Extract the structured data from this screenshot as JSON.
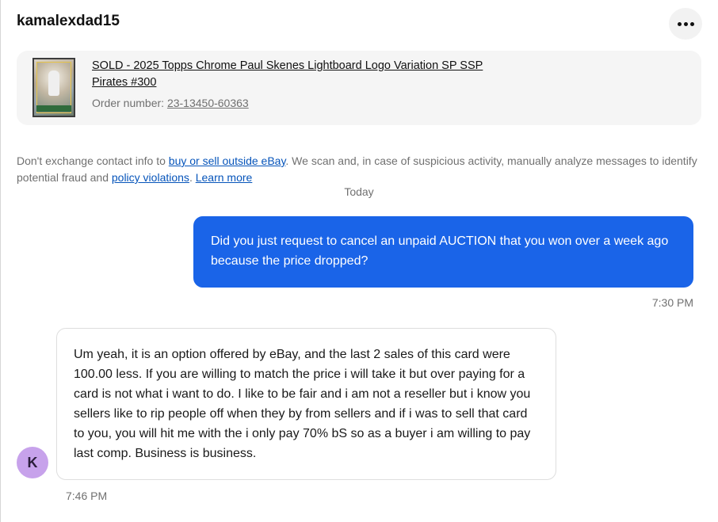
{
  "header": {
    "username": "kamalexdad15",
    "more_icon": "more-horizontal-icon"
  },
  "order": {
    "item_title": "SOLD - 2025 Topps Chrome Paul Skenes Lightboard Logo Variation SP SSP Pirates #300",
    "order_label": "Order number:",
    "order_number": "23-13450-60363"
  },
  "notice": {
    "text_before": "Don't exchange contact info to ",
    "link1": "buy or sell outside eBay",
    "text_middle": ". We scan and, in case of suspicious activity, manually analyze messages to identify potential fraud and ",
    "link2": "policy violations",
    "text_after": ". ",
    "link3": "Learn more"
  },
  "conversation": {
    "day_label": "Today",
    "messages": [
      {
        "direction": "outgoing",
        "text": "Did you just request to cancel an unpaid AUCTION that you won over a week ago because the price dropped?",
        "time": "7:30 PM"
      },
      {
        "direction": "incoming",
        "avatar_initial": "K",
        "text": "Um yeah, it is an option offered by eBay, and the last 2 sales of this card were 100.00 less. If you are willing to match the price i will take it but over paying for a card is not what i want to do. I like to be fair and i am not a reseller but i know you sellers like to rip people off when they by from sellers and if i was to sell that card to you, you will hit me with the i only pay 70% bS so as a buyer i am willing to pay last comp. Business is business.",
        "time": "7:46 PM"
      }
    ]
  },
  "colors": {
    "outgoing_bubble": "#1a64e8",
    "avatar_bg": "#c7a2eb",
    "link": "#0654ba"
  }
}
